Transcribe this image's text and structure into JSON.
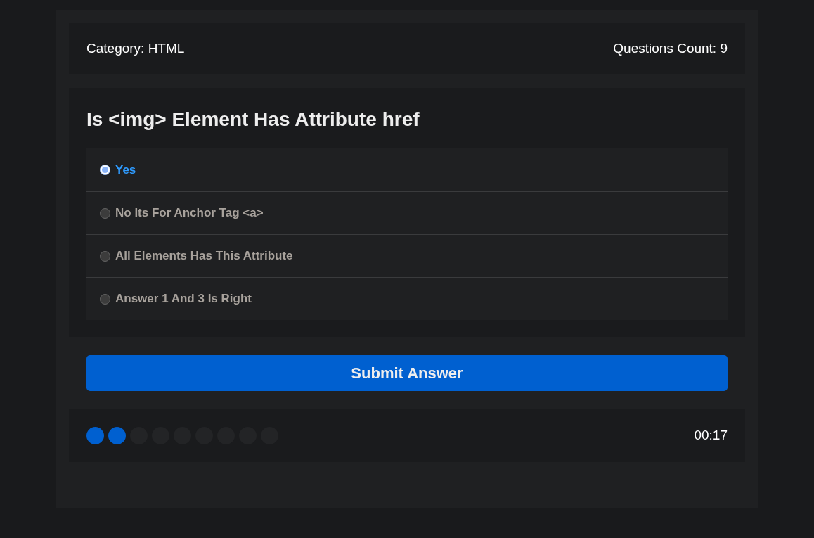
{
  "header": {
    "category": "Category: HTML",
    "count": "Questions Count: 9"
  },
  "question": {
    "title": "Is <img> Element Has Attribute href"
  },
  "answers": [
    {
      "label": "Yes",
      "selected": true
    },
    {
      "label": "No Its For Anchor Tag <a>",
      "selected": false
    },
    {
      "label": "All Elements Has This Attribute",
      "selected": false
    },
    {
      "label": "Answer 1 And 3 Is Right",
      "selected": false
    }
  ],
  "submit": {
    "label": "Submit Answer"
  },
  "progress": [
    {
      "filled": true
    },
    {
      "filled": true
    },
    {
      "filled": false
    },
    {
      "filled": false
    },
    {
      "filled": false
    },
    {
      "filled": false
    },
    {
      "filled": false
    },
    {
      "filled": false
    },
    {
      "filled": false
    }
  ],
  "timer": "00:17"
}
